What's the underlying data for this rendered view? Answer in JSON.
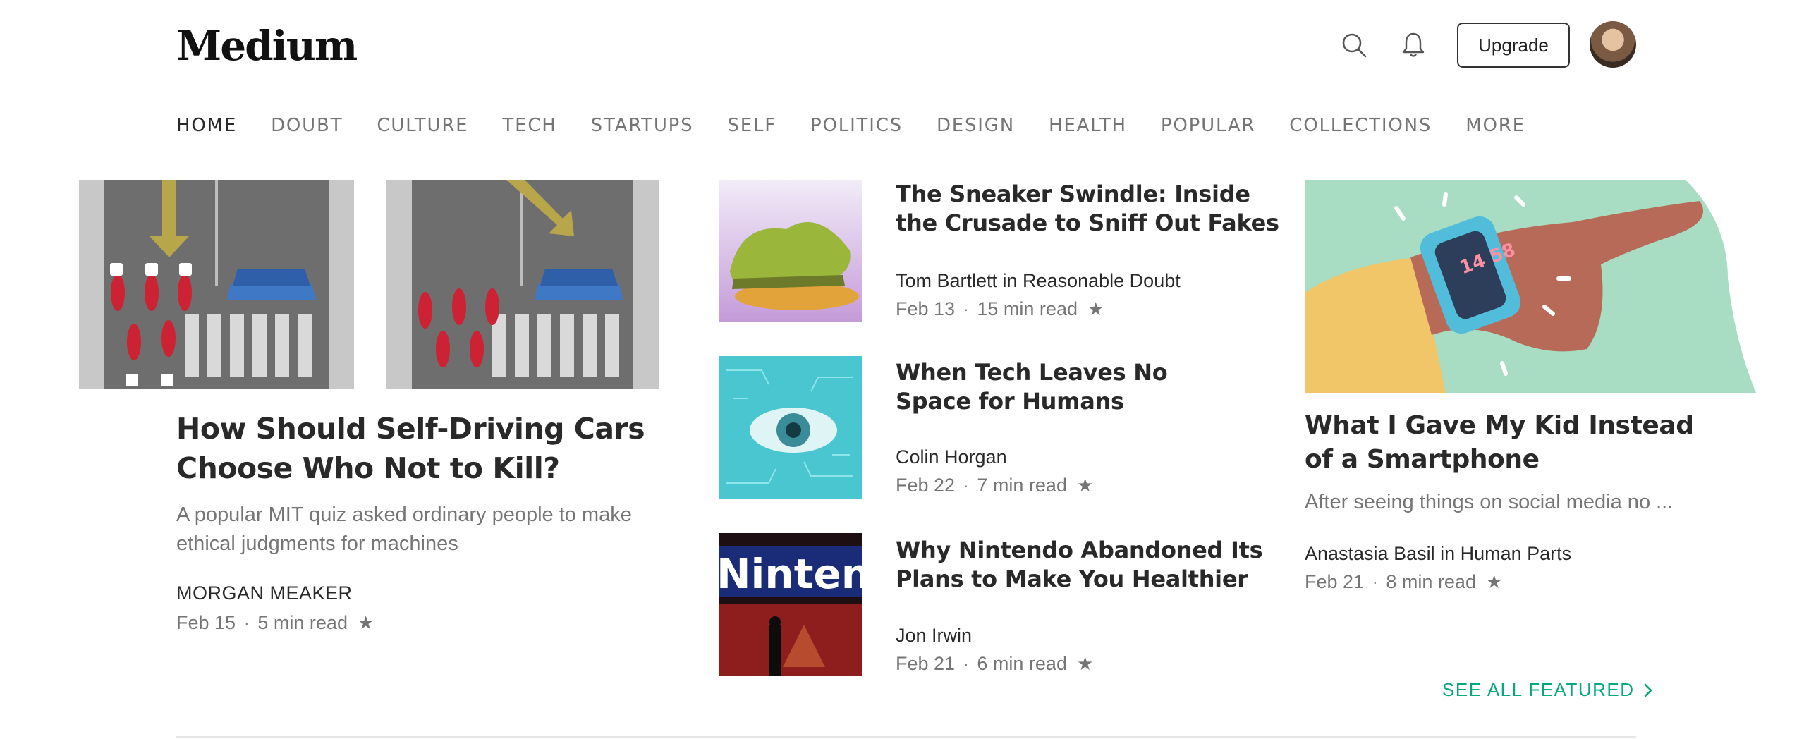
{
  "header": {
    "logo": "Medium",
    "upgrade_label": "Upgrade",
    "icons": [
      "search-icon",
      "bell-icon"
    ]
  },
  "nav": {
    "items": [
      "HOME",
      "DOUBT",
      "CULTURE",
      "TECH",
      "STARTUPS",
      "SELF",
      "POLITICS",
      "DESIGN",
      "HEALTH",
      "POPULAR",
      "COLLECTIONS",
      "MORE"
    ],
    "active": "HOME"
  },
  "lead": {
    "title": "How Should Self-Driving Cars Choose Who Not to Kill?",
    "subtitle": "A popular MIT quiz asked ordinary people to make ethical judgments for machines",
    "author": "MORGAN MEAKER",
    "date": "Feb 15",
    "read_time": "5 min read"
  },
  "middle": [
    {
      "title": "The Sneaker Swindle: Inside the Crusade to Sniff Out Fakes",
      "author": "Tom Bartlett in Reasonable Doubt",
      "date": "Feb 13",
      "read_time": "15 min read"
    },
    {
      "title": "When Tech Leaves No Space for Humans",
      "author": "Colin Horgan",
      "date": "Feb 22",
      "read_time": "7 min read"
    },
    {
      "title": "Why Nintendo Abandoned Its Plans to Make You Healthier",
      "author": "Jon Irwin",
      "date": "Feb 21",
      "read_time": "6 min read",
      "image_text": "Nintend"
    }
  ],
  "right": {
    "title": "What I Gave My Kid Instead of a Smartphone",
    "subtitle": "After seeing things on social media no ...",
    "author": "Anastasia Basil in Human Parts",
    "date": "Feb 21",
    "read_time": "8 min read",
    "watch_digits": "14 58"
  },
  "see_all": "SEE ALL FEATURED",
  "dot": "·",
  "star": "★",
  "colors": {
    "accent": "#03a87c",
    "text": "rgba(0,0,0,0.84)",
    "muted": "rgba(0,0,0,0.54)"
  }
}
